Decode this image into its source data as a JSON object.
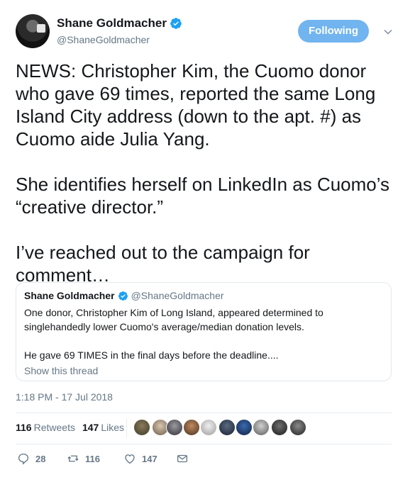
{
  "author": {
    "name": "Shane Goldmacher",
    "handle": "@ShaneGoldmacher",
    "follow_label": "Following"
  },
  "tweet": {
    "paragraphs": [
      "NEWS: Christopher Kim, the Cuomo donor who gave 69 times, reported the same Long Island City address (down to the apt. #) as Cuomo aide Julia Yang.",
      "She identifies herself on LinkedIn as Cuomo’s “creative director.”",
      "I’ve reached out to the campaign for comment…"
    ]
  },
  "quoted_tweet": {
    "name": "Shane Goldmacher",
    "handle": "@ShaneGoldmacher",
    "paragraphs": [
      "One donor, Christopher Kim of Long Island, appeared determined to singlehandedly lower Cuomo's average/median donation levels.",
      "He gave 69 TIMES in the final days before the deadline...."
    ],
    "show_thread": "Show this thread"
  },
  "timestamp": "1:18 PM - 17 Jul 2018",
  "stats": {
    "retweets_count": "116",
    "retweets_label": "Retweets",
    "likes_count": "147",
    "likes_label": "Likes"
  },
  "actions": {
    "replies": "28",
    "retweets": "116",
    "likes": "147"
  },
  "colors": {
    "accent": "#1da1f2",
    "follow_bg": "#71b4ef",
    "muted": "#657786",
    "border": "#e1e8ed"
  },
  "icons": [
    "verified-icon",
    "caret-down-icon",
    "reply-icon",
    "retweet-icon",
    "heart-icon",
    "dm-icon"
  ]
}
